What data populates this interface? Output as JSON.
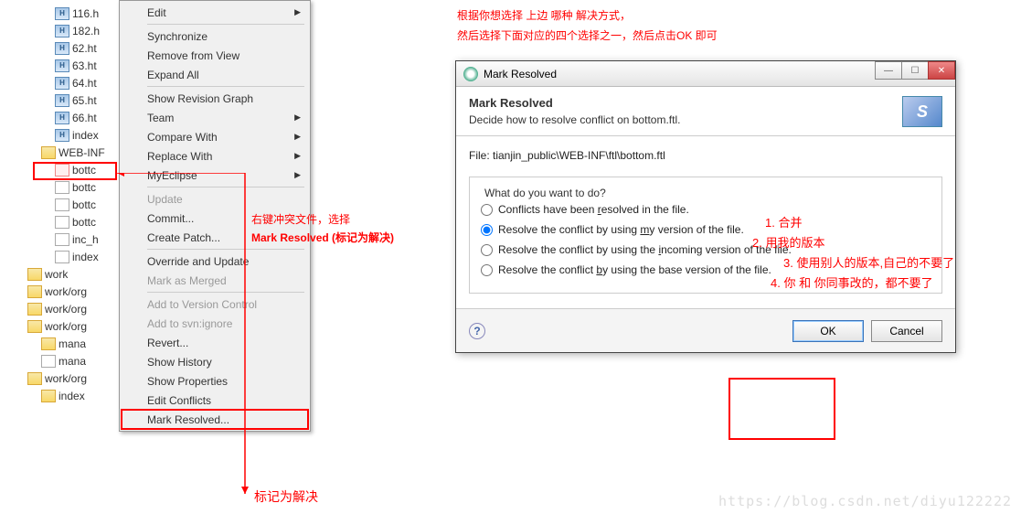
{
  "tree": {
    "items": [
      {
        "label": "116.h",
        "icon": "h",
        "lvl": 2
      },
      {
        "label": "182.h",
        "icon": "h",
        "lvl": 2
      },
      {
        "label": "62.ht",
        "icon": "h",
        "lvl": 2
      },
      {
        "label": "63.ht",
        "icon": "h",
        "lvl": 2
      },
      {
        "label": "64.ht",
        "icon": "h",
        "lvl": 2
      },
      {
        "label": "65.ht",
        "icon": "h",
        "lvl": 2
      },
      {
        "label": "66.ht",
        "icon": "h",
        "lvl": 2
      },
      {
        "label": "index",
        "icon": "h",
        "lvl": 2
      },
      {
        "label": "WEB-INF",
        "icon": "folder",
        "lvl": 1,
        "exp": "▾"
      },
      {
        "label": "bottc",
        "icon": "bottc",
        "lvl": 2,
        "hl": true
      },
      {
        "label": "bottc",
        "icon": "file",
        "lvl": 2
      },
      {
        "label": "bottc",
        "icon": "file",
        "lvl": 2
      },
      {
        "label": "bottc",
        "icon": "file",
        "lvl": 2
      },
      {
        "label": "inc_h",
        "icon": "file",
        "lvl": 2
      },
      {
        "label": "index",
        "icon": "file",
        "lvl": 2
      },
      {
        "label": "work",
        "icon": "folder",
        "lvl": 0,
        "exp": "▸"
      },
      {
        "label": "work/org",
        "icon": "folder",
        "lvl": 0
      },
      {
        "label": "work/org",
        "icon": "folder",
        "lvl": 0
      },
      {
        "label": "work/org",
        "icon": "folder",
        "lvl": 0,
        "exp": "▾"
      },
      {
        "label": "mana",
        "icon": "folder",
        "lvl": 1
      },
      {
        "label": "mana",
        "icon": "file",
        "lvl": 1
      },
      {
        "label": "work/org",
        "icon": "folder",
        "lvl": 0,
        "exp": "▾"
      },
      {
        "label": "index",
        "icon": "folder",
        "lvl": 1
      }
    ]
  },
  "menu": {
    "groups": [
      [
        {
          "label": "Edit",
          "sub": true
        }
      ],
      [
        {
          "label": "Synchronize"
        },
        {
          "label": "Remove from View"
        },
        {
          "label": "Expand All"
        }
      ],
      [
        {
          "label": "Show Revision Graph"
        },
        {
          "label": "Team",
          "sub": true
        },
        {
          "label": "Compare With",
          "sub": true
        },
        {
          "label": "Replace With",
          "sub": true
        },
        {
          "label": "MyEclipse",
          "sub": true
        }
      ],
      [
        {
          "label": "Update",
          "disabled": true
        },
        {
          "label": "Commit..."
        },
        {
          "label": "Create Patch..."
        }
      ],
      [
        {
          "label": "Override and Update"
        },
        {
          "label": "Mark as Merged",
          "disabled": true
        }
      ],
      [
        {
          "label": "Add to Version Control",
          "disabled": true
        },
        {
          "label": "Add to svn:ignore",
          "disabled": true
        },
        {
          "label": "Revert..."
        },
        {
          "label": "Show History"
        },
        {
          "label": "Show Properties"
        },
        {
          "label": "Edit Conflicts"
        },
        {
          "label": "Mark Resolved...",
          "hl": true
        }
      ]
    ]
  },
  "annotations": {
    "note1_l1": "右键冲突文件，选择",
    "note1_l2": "Mark Resolved (标记为解决)",
    "mark_resolved_tag": "标记为解决",
    "top_l1": "根据你想选择 上边 哪种 解决方式，",
    "top_l2": "然后选择下面对应的四个选择之一，然后点击OK 即可",
    "opt1": "1. 合并",
    "opt2": "2. 用我的版本",
    "opt3": "3. 使用别人的版本,自己的不要了",
    "opt4": "4. 你 和 你同事改的，都不要了"
  },
  "dialog": {
    "title": "Mark Resolved",
    "header_title": "Mark Resolved",
    "header_sub": "Decide how to resolve conflict on bottom.ftl.",
    "file_label": "File: tianjin_public\\WEB-INF\\ftl\\bottom.ftl",
    "group_title": "What do you want to do?",
    "options": [
      "Conflicts have been resolved in the file.",
      "Resolve the conflict by using my version of the file.",
      "Resolve the conflict by using the incoming version of the file.",
      "Resolve the conflict by using the base version of the file."
    ],
    "selected": 1,
    "ok": "OK",
    "cancel": "Cancel"
  },
  "watermark": "https://blog.csdn.net/diyu122222"
}
